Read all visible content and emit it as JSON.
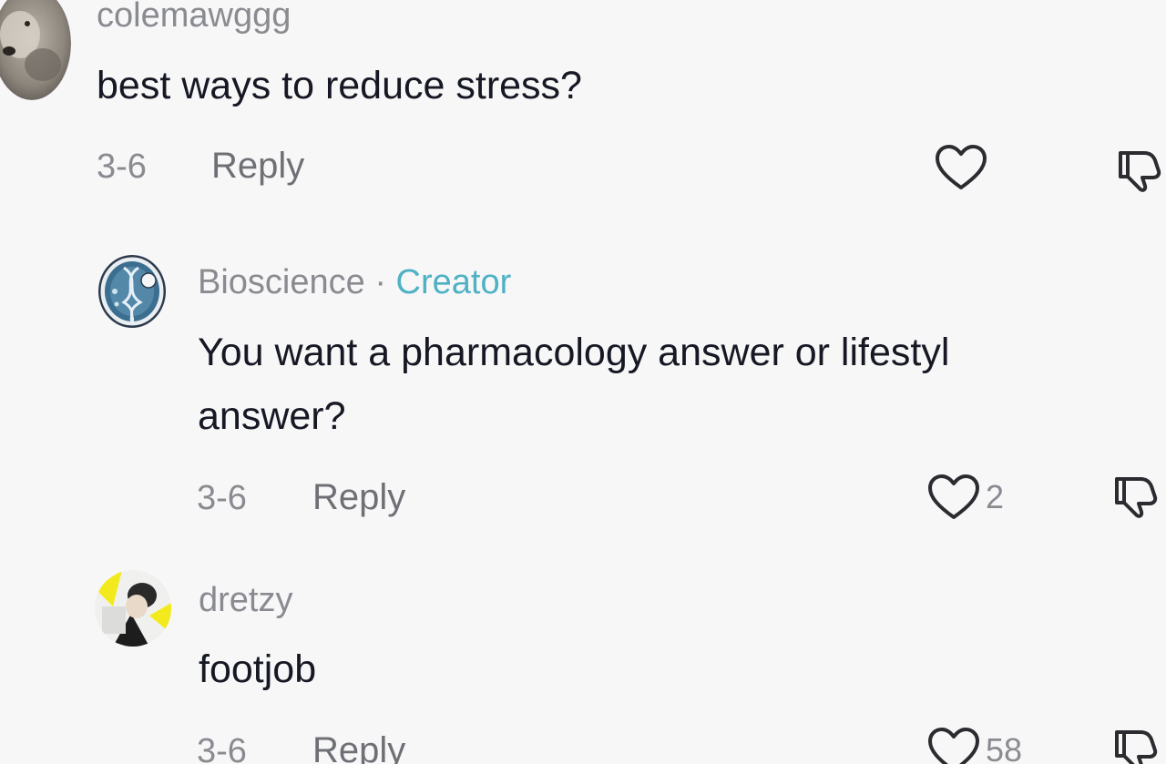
{
  "comments": [
    {
      "username": "colemawggg",
      "text": "best ways to reduce stress?",
      "date": "3-6",
      "reply_label": "Reply",
      "like_count": "",
      "avatar_icon": "dog-photo-avatar"
    },
    {
      "username": "Bioscience",
      "separator": "·",
      "badge": "Creator",
      "text_line1": "You want a pharmacology answer or lifestyl",
      "text_line2": "answer?",
      "date": "3-6",
      "reply_label": "Reply",
      "like_count": "2",
      "avatar_icon": "dna-logo-avatar"
    },
    {
      "username": "dretzy",
      "text": "footjob",
      "date": "3-6",
      "reply_label": "Reply",
      "like_count": "58",
      "avatar_icon": "person-photo-avatar"
    }
  ],
  "colors": {
    "background": "#f7f7f8",
    "text": "#161823",
    "muted": "#8a8b91",
    "creator_accent": "#4fb1c4"
  },
  "icons": {
    "like": "heart-outline-icon",
    "dislike": "thumbs-down-outline-icon"
  }
}
